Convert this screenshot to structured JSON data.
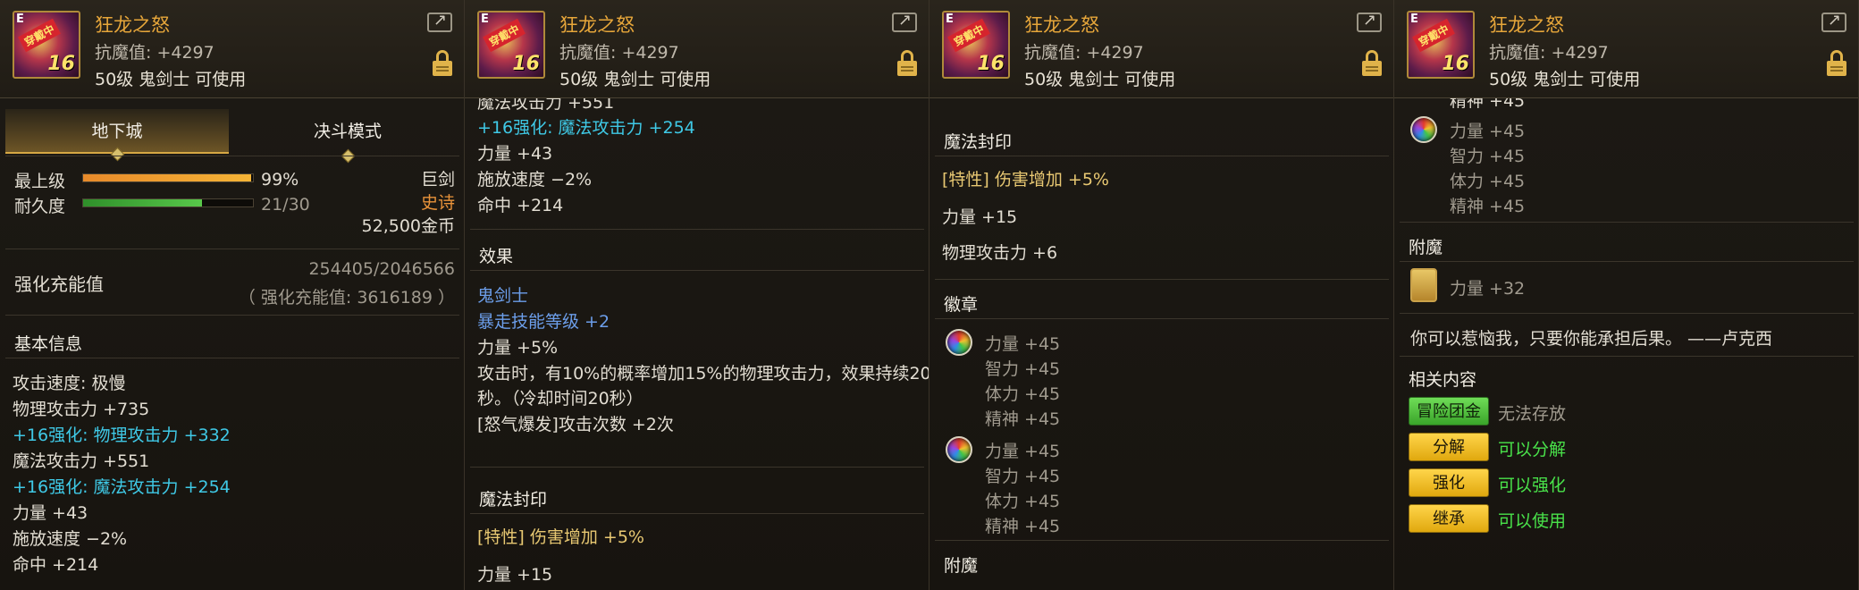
{
  "item": {
    "name": "狂龙之怒",
    "resist": "抗魔值: +4297",
    "requirement": "50级 鬼剑士 可使用",
    "icon_tag": "E",
    "icon_ribbon": "穿戴中",
    "icon_level": "16"
  },
  "panel1": {
    "tabs": [
      "地下城",
      "决斗模式"
    ],
    "grade_label": "最上级",
    "grade_value": "99%",
    "grade_pct": 99,
    "durability_label": "耐久度",
    "durability_value": "21/30",
    "durability_pct": 70,
    "weapon_type": "巨剑",
    "rarity": "史诗",
    "price": "52,500金币",
    "charge_label": "强化充能值",
    "charge_value": "254405/2046566",
    "charge_note": "（ 强化充能值: 3616189 ）",
    "basic_title": "基本信息",
    "stats": [
      {
        "text": "攻击速度: 极慢",
        "color": "white"
      },
      {
        "text": "物理攻击力 +735",
        "color": "white"
      },
      {
        "text": "+16强化: 物理攻击力 +332",
        "color": "cyan"
      },
      {
        "text": "魔法攻击力 +551",
        "color": "white"
      },
      {
        "text": "+16强化: 魔法攻击力 +254",
        "color": "cyan"
      },
      {
        "text": "力量 +43",
        "color": "white"
      },
      {
        "text": "施放速度 −2%",
        "color": "white"
      },
      {
        "text": "命中 +214",
        "color": "white"
      }
    ]
  },
  "panel2": {
    "top_cut": "魔法攻击力 +551",
    "stats": [
      {
        "text": "+16强化: 魔法攻击力 +254",
        "color": "cyan"
      },
      {
        "text": "力量 +43",
        "color": "white"
      },
      {
        "text": "施放速度 −2%",
        "color": "white"
      },
      {
        "text": "命中 +214",
        "color": "white"
      }
    ],
    "effect_title": "效果",
    "effect_class": "鬼剑士",
    "effect_skill": "暴走技能等级 +2",
    "effect_str": "力量 +5%",
    "effect_desc1": "攻击时，有10%的概率增加15%的物理攻击力，效果持续20",
    "effect_desc2": "秒。（冷却时间20秒）",
    "effect_rage": "[怒气爆发]攻击次数 +2次",
    "seal_title": "魔法封印",
    "seal_trait": "[特性] 伤害增加 +5%",
    "seal_str": "力量 +15"
  },
  "panel3": {
    "seal_title": "魔法封印",
    "seal_trait": "[特性] 伤害增加 +5%",
    "seal_str": "力量 +15",
    "seal_atk": "物理攻击力 +6",
    "emblem_title": "徽章",
    "emblem1": [
      "力量 +45",
      "智力 +45",
      "体力 +45",
      "精神 +45"
    ],
    "emblem2": [
      "力量 +45",
      "智力 +45",
      "体力 +45",
      "精神 +45"
    ],
    "enchant_title": "附魔"
  },
  "panel4": {
    "top_cut": "精神 +45",
    "emblem": [
      "力量 +45",
      "智力 +45",
      "体力 +45",
      "精神 +45"
    ],
    "enchant_title": "附魔",
    "enchant_value": "力量 +32",
    "quote": "你可以惹恼我，只要你能承担后果。 ——卢克西",
    "related_title": "相关内容",
    "related": [
      {
        "button": "冒险团金库",
        "status": "无法存放",
        "style": "green"
      },
      {
        "button": "分解",
        "status": "可以分解",
        "style": "gold"
      },
      {
        "button": "强化",
        "status": "可以强化",
        "style": "gold"
      },
      {
        "button": "继承",
        "status": "可以使用",
        "style": "gold"
      }
    ]
  },
  "colors": {
    "cyan": "#3fc9e6",
    "gold": "#e8c872",
    "orange": "#e9933a",
    "green": "#49e24a",
    "title": "#e6a63a"
  }
}
